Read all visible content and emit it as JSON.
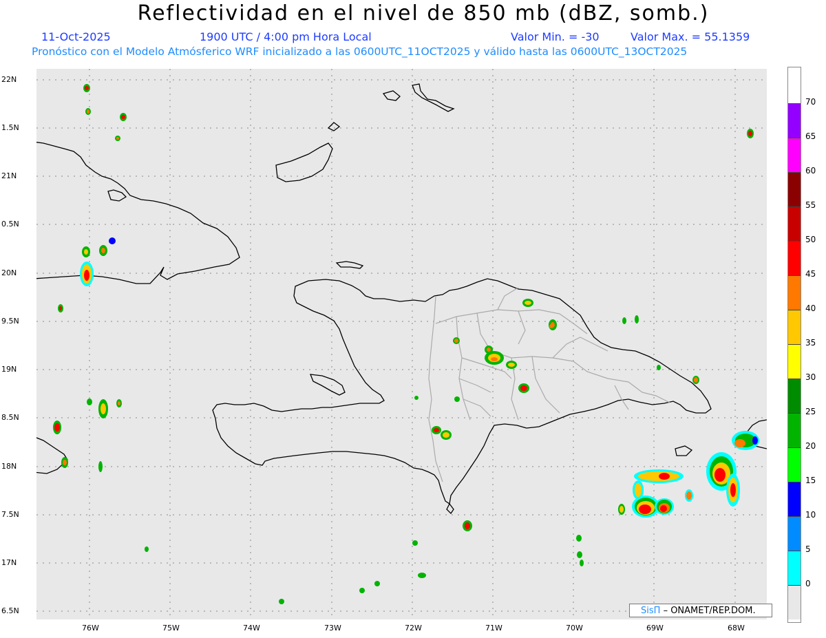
{
  "header": {
    "title": "Reflectividad en el nivel de 850 mb (dBZ, somb.)",
    "date": "11-Oct-2025",
    "time": "1900 UTC / 4:00 pm Hora Local",
    "min_label": "Valor Min. = -30",
    "max_label": "Valor Max. = 55.1359",
    "forecast_line": "Pronóstico con el Modelo Atmósferico WRF inicializado a las 0600UTC_11OCT2025 y válido hasta las  0600UTC_13OCT2025"
  },
  "axes": {
    "lat_labels": [
      "22N",
      "1.5N",
      "21N",
      "0.5N",
      "20N",
      "9.5N",
      "19N",
      "8.5N",
      "18N",
      "7.5N",
      "17N",
      "6.5N"
    ],
    "lon_labels": [
      "76W",
      "75W",
      "74W",
      "73W",
      "72W",
      "71W",
      "70W",
      "69W",
      "68W"
    ]
  },
  "colorbar": {
    "labels": [
      "70",
      "65",
      "60",
      "55",
      "50",
      "45",
      "40",
      "35",
      "30",
      "25",
      "20",
      "15",
      "10",
      "5",
      "0"
    ],
    "colors": [
      "#9400ff",
      "#ff00ff",
      "#8b0000",
      "#c80000",
      "#ff0000",
      "#ff7800",
      "#ffc800",
      "#ffff00",
      "#008c00",
      "#00b400",
      "#00ff00",
      "#0000ff",
      "#008cff",
      "#00ffff",
      "#e8e8e8"
    ]
  },
  "credit": {
    "brand": "SisΠ",
    "text": "– ONAMET/REP.DOM."
  },
  "legend_colors": {
    "map_background": "#e8e8e8",
    "gridline": "#888888",
    "coast": "#000000",
    "province_border": "#aaaaaa"
  }
}
